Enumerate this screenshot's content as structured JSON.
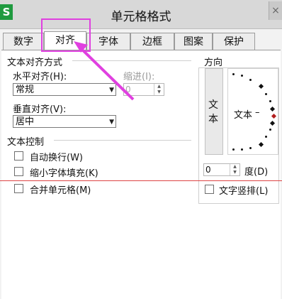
{
  "window": {
    "title": "单元格格式",
    "app_icon": "S",
    "close": "×"
  },
  "tabs": [
    {
      "label": "数字",
      "active": false
    },
    {
      "label": "对齐",
      "active": true
    },
    {
      "label": "字体",
      "active": false
    },
    {
      "label": "边框",
      "active": false
    },
    {
      "label": "图案",
      "active": false
    },
    {
      "label": "保护",
      "active": false
    }
  ],
  "text_alignment": {
    "group_title": "文本对齐方式",
    "horizontal_label": "水平对齐(H):",
    "horizontal_value": "常规",
    "indent_label": "缩进(I):",
    "indent_value": "0",
    "vertical_label": "垂直对齐(V):",
    "vertical_value": "居中"
  },
  "text_control": {
    "group_title": "文本控制",
    "wrap_text": "自动换行(W)",
    "shrink_to_fit": "缩小字体填充(K)",
    "merge_cells": "合并单元格(M)"
  },
  "orientation": {
    "group_title": "方向",
    "vertical_text_chars": [
      "文",
      "本"
    ],
    "dial_text": "文本",
    "degree_value": "0",
    "degree_label": "度(D)",
    "vertical_text_checkbox": "文字竖排(L)"
  },
  "colors": {
    "highlight": "#e040e0",
    "app_green": "#1f9a3f",
    "guide_red": "#d44"
  }
}
